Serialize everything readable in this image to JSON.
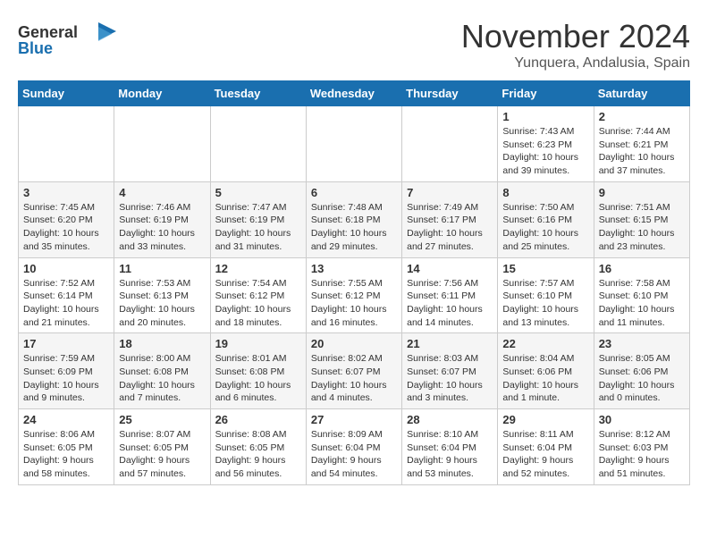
{
  "logo": {
    "general": "General",
    "blue": "Blue"
  },
  "title": {
    "month": "November 2024",
    "location": "Yunquera, Andalusia, Spain"
  },
  "calendar": {
    "headers": [
      "Sunday",
      "Monday",
      "Tuesday",
      "Wednesday",
      "Thursday",
      "Friday",
      "Saturday"
    ],
    "weeks": [
      [
        {
          "day": "",
          "info": ""
        },
        {
          "day": "",
          "info": ""
        },
        {
          "day": "",
          "info": ""
        },
        {
          "day": "",
          "info": ""
        },
        {
          "day": "",
          "info": ""
        },
        {
          "day": "1",
          "info": "Sunrise: 7:43 AM\nSunset: 6:23 PM\nDaylight: 10 hours and 39 minutes."
        },
        {
          "day": "2",
          "info": "Sunrise: 7:44 AM\nSunset: 6:21 PM\nDaylight: 10 hours and 37 minutes."
        }
      ],
      [
        {
          "day": "3",
          "info": "Sunrise: 7:45 AM\nSunset: 6:20 PM\nDaylight: 10 hours and 35 minutes."
        },
        {
          "day": "4",
          "info": "Sunrise: 7:46 AM\nSunset: 6:19 PM\nDaylight: 10 hours and 33 minutes."
        },
        {
          "day": "5",
          "info": "Sunrise: 7:47 AM\nSunset: 6:19 PM\nDaylight: 10 hours and 31 minutes."
        },
        {
          "day": "6",
          "info": "Sunrise: 7:48 AM\nSunset: 6:18 PM\nDaylight: 10 hours and 29 minutes."
        },
        {
          "day": "7",
          "info": "Sunrise: 7:49 AM\nSunset: 6:17 PM\nDaylight: 10 hours and 27 minutes."
        },
        {
          "day": "8",
          "info": "Sunrise: 7:50 AM\nSunset: 6:16 PM\nDaylight: 10 hours and 25 minutes."
        },
        {
          "day": "9",
          "info": "Sunrise: 7:51 AM\nSunset: 6:15 PM\nDaylight: 10 hours and 23 minutes."
        }
      ],
      [
        {
          "day": "10",
          "info": "Sunrise: 7:52 AM\nSunset: 6:14 PM\nDaylight: 10 hours and 21 minutes."
        },
        {
          "day": "11",
          "info": "Sunrise: 7:53 AM\nSunset: 6:13 PM\nDaylight: 10 hours and 20 minutes."
        },
        {
          "day": "12",
          "info": "Sunrise: 7:54 AM\nSunset: 6:12 PM\nDaylight: 10 hours and 18 minutes."
        },
        {
          "day": "13",
          "info": "Sunrise: 7:55 AM\nSunset: 6:12 PM\nDaylight: 10 hours and 16 minutes."
        },
        {
          "day": "14",
          "info": "Sunrise: 7:56 AM\nSunset: 6:11 PM\nDaylight: 10 hours and 14 minutes."
        },
        {
          "day": "15",
          "info": "Sunrise: 7:57 AM\nSunset: 6:10 PM\nDaylight: 10 hours and 13 minutes."
        },
        {
          "day": "16",
          "info": "Sunrise: 7:58 AM\nSunset: 6:10 PM\nDaylight: 10 hours and 11 minutes."
        }
      ],
      [
        {
          "day": "17",
          "info": "Sunrise: 7:59 AM\nSunset: 6:09 PM\nDaylight: 10 hours and 9 minutes."
        },
        {
          "day": "18",
          "info": "Sunrise: 8:00 AM\nSunset: 6:08 PM\nDaylight: 10 hours and 7 minutes."
        },
        {
          "day": "19",
          "info": "Sunrise: 8:01 AM\nSunset: 6:08 PM\nDaylight: 10 hours and 6 minutes."
        },
        {
          "day": "20",
          "info": "Sunrise: 8:02 AM\nSunset: 6:07 PM\nDaylight: 10 hours and 4 minutes."
        },
        {
          "day": "21",
          "info": "Sunrise: 8:03 AM\nSunset: 6:07 PM\nDaylight: 10 hours and 3 minutes."
        },
        {
          "day": "22",
          "info": "Sunrise: 8:04 AM\nSunset: 6:06 PM\nDaylight: 10 hours and 1 minute."
        },
        {
          "day": "23",
          "info": "Sunrise: 8:05 AM\nSunset: 6:06 PM\nDaylight: 10 hours and 0 minutes."
        }
      ],
      [
        {
          "day": "24",
          "info": "Sunrise: 8:06 AM\nSunset: 6:05 PM\nDaylight: 9 hours and 58 minutes."
        },
        {
          "day": "25",
          "info": "Sunrise: 8:07 AM\nSunset: 6:05 PM\nDaylight: 9 hours and 57 minutes."
        },
        {
          "day": "26",
          "info": "Sunrise: 8:08 AM\nSunset: 6:05 PM\nDaylight: 9 hours and 56 minutes."
        },
        {
          "day": "27",
          "info": "Sunrise: 8:09 AM\nSunset: 6:04 PM\nDaylight: 9 hours and 54 minutes."
        },
        {
          "day": "28",
          "info": "Sunrise: 8:10 AM\nSunset: 6:04 PM\nDaylight: 9 hours and 53 minutes."
        },
        {
          "day": "29",
          "info": "Sunrise: 8:11 AM\nSunset: 6:04 PM\nDaylight: 9 hours and 52 minutes."
        },
        {
          "day": "30",
          "info": "Sunrise: 8:12 AM\nSunset: 6:03 PM\nDaylight: 9 hours and 51 minutes."
        }
      ]
    ]
  }
}
